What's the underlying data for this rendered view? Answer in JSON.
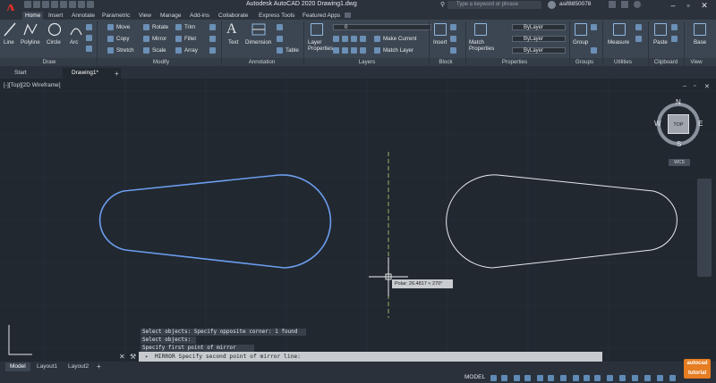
{
  "app": {
    "title": "Autodesk AutoCAD 2020    Drawing1.dwg",
    "logo_letter": "A"
  },
  "search": {
    "placeholder": "Type a keyword or phrase"
  },
  "user": {
    "name": "asif8850078"
  },
  "ribbon_tabs": [
    "Home",
    "Insert",
    "Annotate",
    "Parametric",
    "View",
    "Manage",
    "Add-ins",
    "Collaborate",
    "Express Tools",
    "Featured Apps"
  ],
  "draw": {
    "line": "Line",
    "polyline": "Polyline",
    "circle": "Circle",
    "arc": "Arc",
    "label": "Draw"
  },
  "modify": {
    "move": "Move",
    "rotate": "Rotate",
    "trim": "Trim",
    "copy": "Copy",
    "mirror": "Mirror",
    "fillet": "Fillet",
    "stretch": "Stretch",
    "scale": "Scale",
    "array": "Array",
    "label": "Modify"
  },
  "annotation": {
    "text": "Text",
    "dimension": "Dimension",
    "table": "Table",
    "label": "Annotation"
  },
  "layers": {
    "layer_properties": "Layer Properties",
    "current_layer": "0",
    "make_current": "Make Current",
    "match_layer": "Match Layer",
    "label": "Layers"
  },
  "block": {
    "insert": "Insert",
    "label": "Block"
  },
  "properties": {
    "match_properties": "Match Properties",
    "bylayer1": "ByLayer",
    "bylayer2": "ByLayer",
    "bylayer3": "ByLayer",
    "label": "Properties"
  },
  "groups": {
    "group": "Group",
    "label": "Groups"
  },
  "utilities": {
    "measure": "Measure",
    "label": "Utilities"
  },
  "clipboard": {
    "paste": "Paste",
    "label": "Clipboard"
  },
  "view_panel": {
    "base": "Base",
    "label": "View"
  },
  "doc_tabs": {
    "start": "Start",
    "drawing": "Drawing1*"
  },
  "viewport": {
    "label": "[-][Top][2D Wireframe]"
  },
  "viewcube": {
    "n": "N",
    "s": "S",
    "e": "E",
    "w": "W",
    "top": "TOP",
    "wcs": "WCS"
  },
  "tooltip": {
    "text": "Polar: 26.4817 < 270°"
  },
  "command_history": [
    "Select objects: Specify opposite corner: 1 found",
    "Select objects:",
    "Specify first point of mirror line:"
  ],
  "command_line": {
    "prompt": "MIRROR Specify second point of mirror line:"
  },
  "layout_tabs": [
    "Model",
    "Layout1",
    "Layout2"
  ],
  "status": {
    "model": "MODEL"
  },
  "watermark": {
    "line1": "autocad",
    "line2": "tutorial"
  },
  "colors": {
    "accent": "#6c9ef0",
    "background": "#212830",
    "ribbon": "#3c4652"
  }
}
